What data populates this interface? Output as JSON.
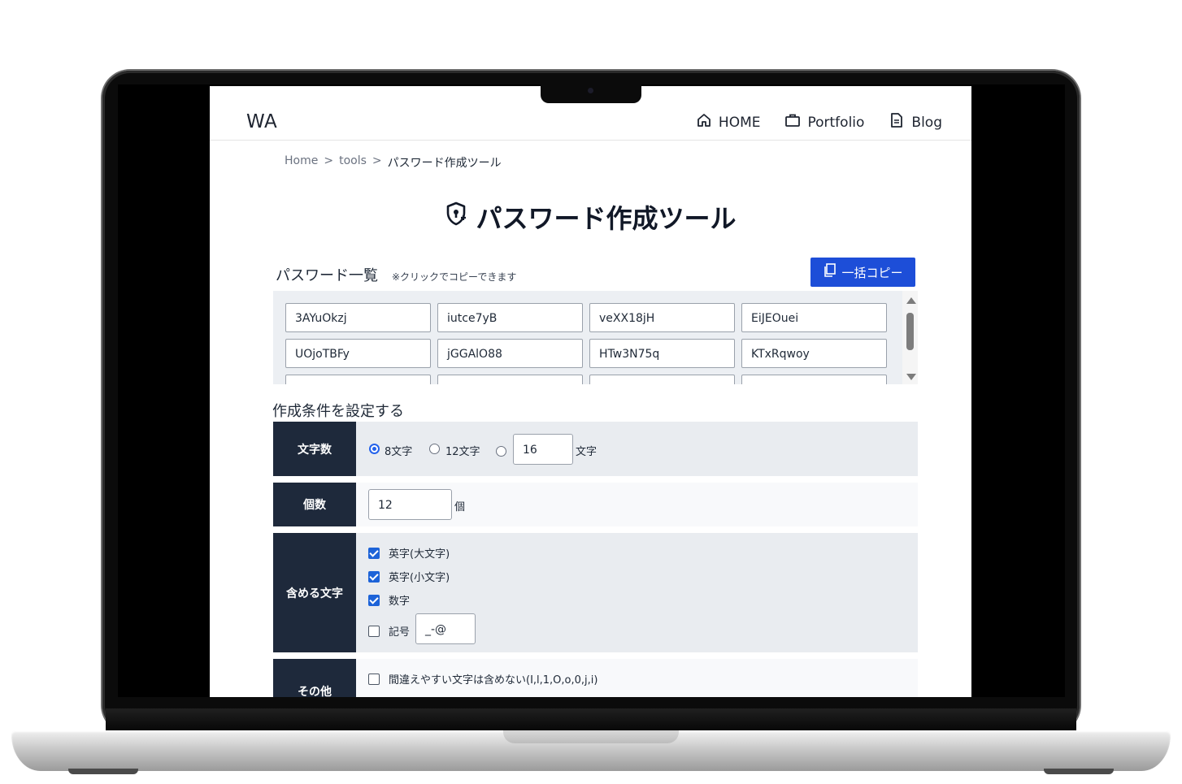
{
  "header": {
    "logo": "WA",
    "nav": [
      {
        "label": "HOME",
        "icon": "home-icon"
      },
      {
        "label": "Portfolio",
        "icon": "briefcase-icon"
      },
      {
        "label": "Blog",
        "icon": "document-icon"
      }
    ]
  },
  "breadcrumb": {
    "items": [
      "Home",
      "tools",
      "パスワード作成ツール"
    ],
    "separator": ">"
  },
  "page": {
    "title": "パスワード作成ツール",
    "title_icon": "shield-lock-icon"
  },
  "password_list": {
    "heading": "パスワード一覧",
    "note": "※クリックでコピーできます",
    "copy_all_label": "一括コピー",
    "passwords": [
      "3AYuOkzj",
      "iutce7yB",
      "veXX18jH",
      "EiJEOuei",
      "UOjoTBFy",
      "jGGAlO88",
      "HTw3N75q",
      "KTxRqwoy",
      "",
      "",
      "",
      ""
    ]
  },
  "settings": {
    "heading": "作成条件を設定する",
    "length": {
      "label": "文字数",
      "options": [
        "8文字",
        "12文字"
      ],
      "selected": "8文字",
      "custom_value": "16",
      "custom_unit": "文字"
    },
    "count": {
      "label": "個数",
      "value": "12",
      "unit": "個"
    },
    "include": {
      "label": "含める文字",
      "uppercase": {
        "label": "英字(大文字)",
        "checked": true
      },
      "lowercase": {
        "label": "英字(小文字)",
        "checked": true
      },
      "digits": {
        "label": "数字",
        "checked": true
      },
      "symbols": {
        "label": "記号",
        "checked": false,
        "value": "_-@"
      }
    },
    "other": {
      "label": "その他",
      "exclude_ambiguous": {
        "label": "間違えやすい文字は含めない(I,l,1,O,o,0,j,i)",
        "checked": false
      }
    }
  },
  "colors": {
    "accent": "#1d4ed8",
    "label_bg": "#1e293b",
    "checkbox": "#1d63d8"
  }
}
